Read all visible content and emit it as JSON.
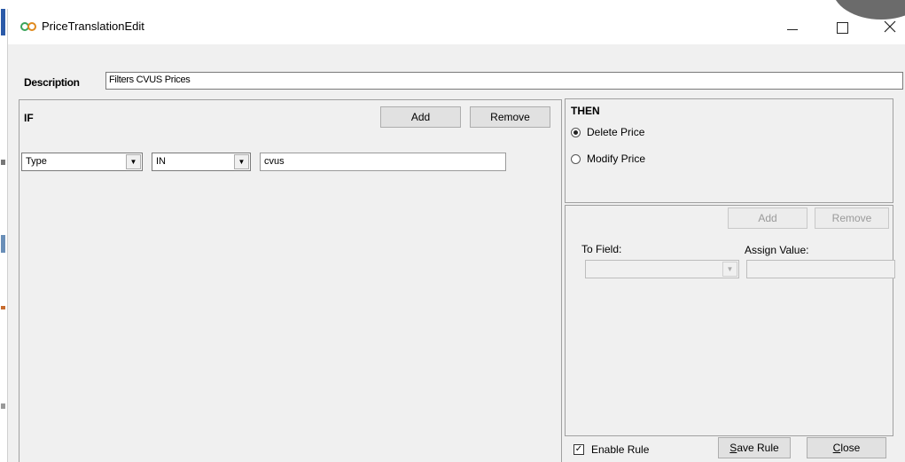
{
  "window": {
    "title": "PriceTranslationEdit",
    "controls": {
      "minimize": "—",
      "maximize": "☐",
      "close": "✕"
    }
  },
  "description": {
    "label": "Description",
    "value": "Filters CVUS Prices"
  },
  "if_panel": {
    "label": "IF",
    "add_label": "Add",
    "remove_label": "Remove",
    "condition": {
      "field": "Type",
      "operator": "IN",
      "value": "cvus"
    }
  },
  "then_panel": {
    "label": "THEN",
    "options": [
      {
        "label": "Delete Price",
        "selected": true
      },
      {
        "label": "Modify Price",
        "selected": false
      }
    ]
  },
  "assign_panel": {
    "add_label": "Add",
    "remove_label": "Remove",
    "to_field_label": "To Field:",
    "assign_value_label": "Assign Value:",
    "to_field_value": "",
    "assign_value": ""
  },
  "footer": {
    "enable_rule_label": "Enable Rule",
    "enable_rule_checked": true,
    "save_prefix": "S",
    "save_rest": "ave Rule",
    "close_prefix": "C",
    "close_rest": "lose"
  },
  "icons": {
    "app": "infinity-icon",
    "dropdown": "chevron-down-icon",
    "check": "checkmark-icon"
  },
  "colors": {
    "window_bg": "#f0f0f0",
    "titlebar_bg": "#ffffff",
    "app_icon": "#3aa35a"
  }
}
